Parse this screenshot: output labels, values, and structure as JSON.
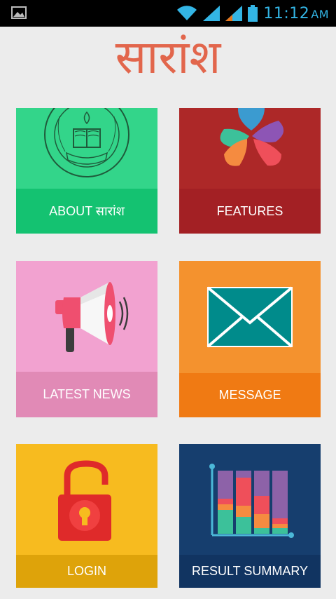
{
  "status_bar": {
    "time": "11:12",
    "ampm": "AM",
    "icons": [
      "gallery-notification-icon",
      "wifi-icon",
      "signal-icon",
      "signal-icon",
      "battery-icon"
    ]
  },
  "app": {
    "title": "सारांश"
  },
  "tiles": [
    {
      "label": "ABOUT सारांश",
      "icon": "cbse-emblem-icon",
      "color": "#33d58a"
    },
    {
      "label": "FEATURES",
      "icon": "flower-petals-icon",
      "color": "#ad2828"
    },
    {
      "label": "LATEST NEWS",
      "icon": "megaphone-icon",
      "color": "#f2a2d0"
    },
    {
      "label": "MESSAGE",
      "icon": "envelope-icon",
      "color": "#f4922e"
    },
    {
      "label": "LOGIN",
      "icon": "padlock-icon",
      "color": "#f7bb1f"
    },
    {
      "label": "RESULT SUMMARY",
      "icon": "bar-chart-icon",
      "color": "#163e6e"
    }
  ]
}
